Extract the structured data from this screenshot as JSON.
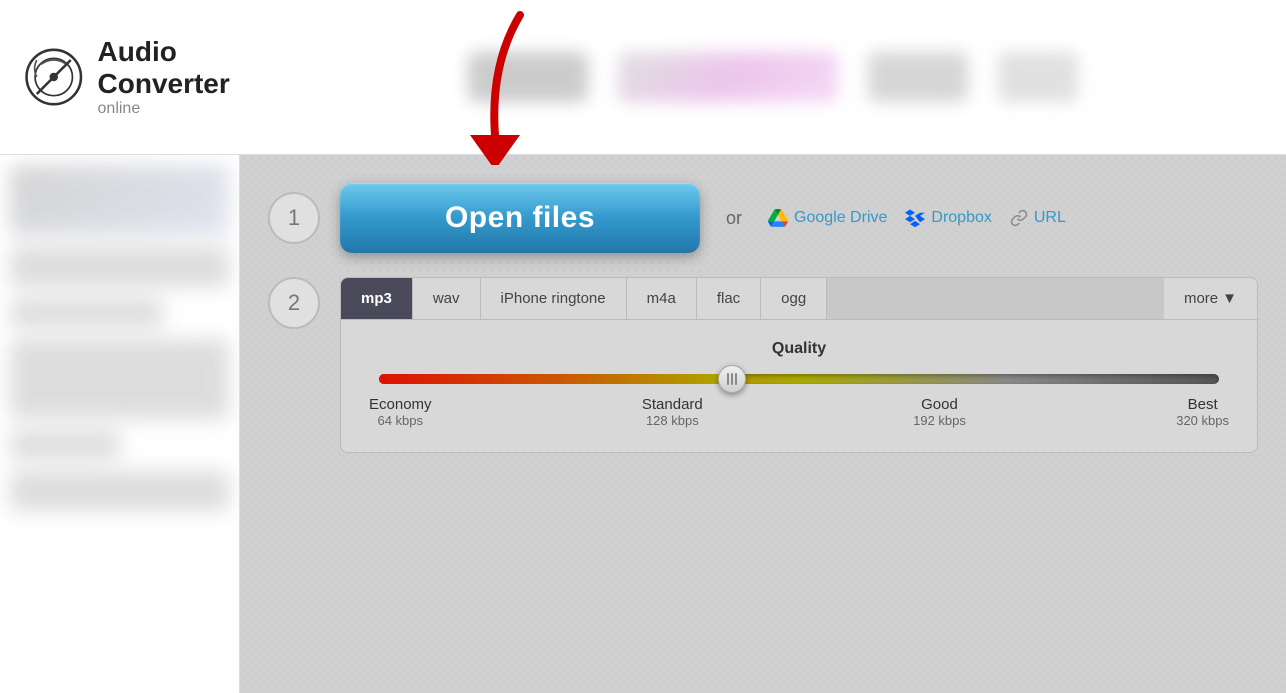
{
  "header": {
    "logo_title": "Audio Converter",
    "logo_subtitle": "online"
  },
  "step1": {
    "number": "1",
    "open_files_label": "Open files",
    "or_text": "or",
    "google_drive_label": "Google Drive",
    "dropbox_label": "Dropbox",
    "url_label": "URL"
  },
  "step2": {
    "number": "2",
    "tabs": [
      {
        "id": "mp3",
        "label": "mp3",
        "active": true
      },
      {
        "id": "wav",
        "label": "wav",
        "active": false
      },
      {
        "id": "iphone-ringtone",
        "label": "iPhone ringtone",
        "active": false
      },
      {
        "id": "m4a",
        "label": "m4a",
        "active": false
      },
      {
        "id": "flac",
        "label": "flac",
        "active": false
      },
      {
        "id": "ogg",
        "label": "ogg",
        "active": false
      },
      {
        "id": "more",
        "label": "more",
        "active": false
      }
    ],
    "quality": {
      "title": "Quality",
      "labels": [
        {
          "name": "Economy",
          "kbps": "64 kbps"
        },
        {
          "name": "Standard",
          "kbps": "128 kbps"
        },
        {
          "name": "Good",
          "kbps": "192 kbps"
        },
        {
          "name": "Best",
          "kbps": "320 kbps"
        }
      ],
      "slider_value": 42
    }
  }
}
